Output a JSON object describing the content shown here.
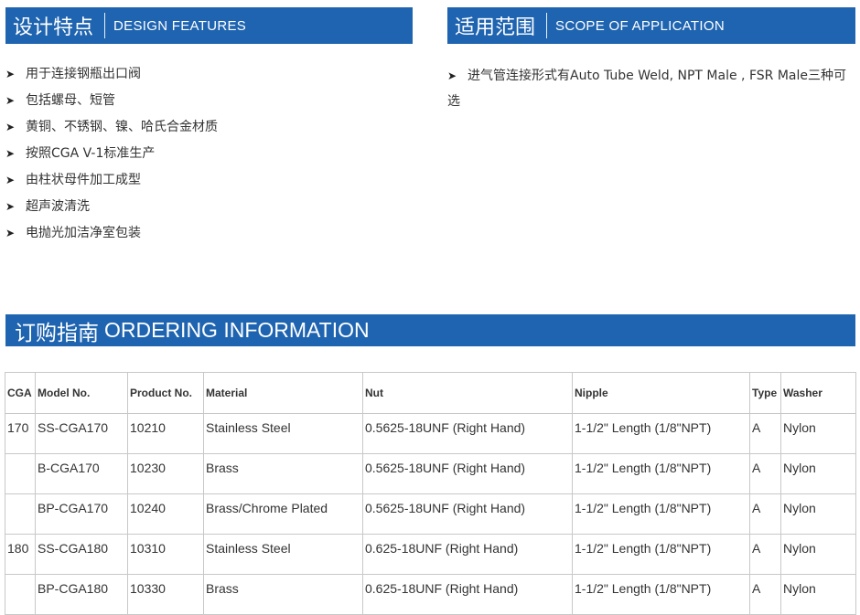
{
  "design": {
    "title_cn": "设计特点",
    "title_en": "DESIGN FEATURES",
    "items": [
      "用于连接钢瓶出口阀",
      "包括螺母、短管",
      "黄铜、不锈钢、镍、哈氏合金材质",
      "按照CGA V-1标准生产",
      "由柱状母件加工成型",
      "超声波清洗",
      "电抛光加洁净室包装"
    ]
  },
  "scope": {
    "title_cn": "适用范围",
    "title_en": "SCOPE OF APPLICATION",
    "text": "进气管连接形式有Auto Tube Weld, NPT Male , FSR Male三种可选"
  },
  "ordering": {
    "title_cn": "订购指南",
    "title_en": "ORDERING INFORMATION",
    "headers": [
      "CGA",
      "Model No.",
      "Product No.",
      "Material",
      "Nut",
      "Nipple",
      "Type",
      "Washer"
    ],
    "rows": [
      [
        "170",
        "SS-CGA170",
        "10210",
        "Stainless Steel",
        "0.5625-18UNF (Right Hand)",
        "1-1/2\" Length (1/8\"NPT)",
        "A",
        "Nylon"
      ],
      [
        "",
        "B-CGA170",
        "10230",
        "Brass",
        "0.5625-18UNF (Right Hand)",
        "1-1/2\" Length (1/8\"NPT)",
        "A",
        "Nylon"
      ],
      [
        "",
        "BP-CGA170",
        "10240",
        "Brass/Chrome Plated",
        "0.5625-18UNF (Right Hand)",
        "1-1/2\" Length (1/8\"NPT)",
        "A",
        "Nylon"
      ],
      [
        "180",
        "SS-CGA180",
        "10310",
        "Stainless Steel",
        "0.625-18UNF (Right Hand)",
        "1-1/2\" Length (1/8\"NPT)",
        "A",
        "Nylon"
      ],
      [
        "",
        "BP-CGA180",
        "10330",
        "Brass",
        "0.625-18UNF (Right Hand)",
        "1-1/2\" Length (1/8\"NPT)",
        "A",
        "Nylon"
      ]
    ]
  },
  "colors": {
    "banner": "#1f64b0",
    "border": "#c8c8c8",
    "text": "#333333"
  },
  "icons": {
    "bullet": "arrowhead-bullet-icon"
  }
}
